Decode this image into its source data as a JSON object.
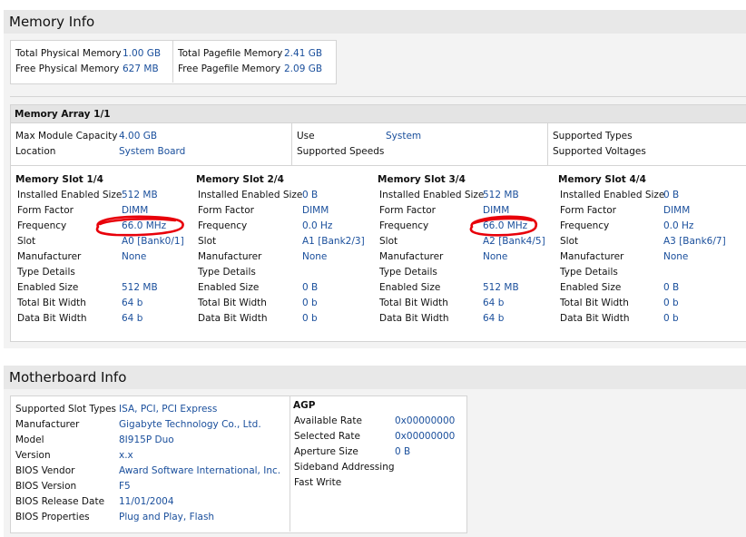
{
  "memory": {
    "title": "Memory Info",
    "summary": [
      {
        "label": "Total Physical Memory",
        "value": "1.00 GB"
      },
      {
        "label": "Free Physical Memory",
        "value": "627 MB"
      },
      {
        "label": "Total Pagefile Memory",
        "value": "2.41 GB"
      },
      {
        "label": "Free Pagefile Memory",
        "value": "2.09 GB"
      }
    ],
    "array": {
      "title": "Memory Array 1/1",
      "max_module_label": "Max Module Capacity",
      "max_module_value": "4.00 GB",
      "location_label": "Location",
      "location_value": "System Board",
      "use_label": "Use",
      "use_value": "System",
      "supported_speeds_label": "Supported Speeds",
      "supported_types_label": "Supported Types",
      "supported_voltages_label": "Supported Voltages"
    },
    "slot_labels": [
      "Installed Enabled Size",
      "Form Factor",
      "Frequency",
      "Slot",
      "Manufacturer",
      "Type Details",
      "Enabled Size",
      "Total Bit Width",
      "Data Bit Width"
    ],
    "slots": [
      {
        "title": "Memory Slot 1/4",
        "values": [
          "512 MB",
          "DIMM",
          "66.0 MHz",
          "A0 [Bank0/1]",
          "None",
          "",
          "512 MB",
          "64 b",
          "64 b"
        ]
      },
      {
        "title": "Memory Slot 2/4",
        "values": [
          "0 B",
          "DIMM",
          "0.0 Hz",
          "A1 [Bank2/3]",
          "None",
          "",
          "0 B",
          "0 b",
          "0 b"
        ]
      },
      {
        "title": "Memory Slot 3/4",
        "values": [
          "512 MB",
          "DIMM",
          "66.0 MHz",
          "A2 [Bank4/5]",
          "None",
          "",
          "512 MB",
          "64 b",
          "64 b"
        ]
      },
      {
        "title": "Memory Slot 4/4",
        "values": [
          "0 B",
          "DIMM",
          "0.0 Hz",
          "A3 [Bank6/7]",
          "None",
          "",
          "0 B",
          "0 b",
          "0 b"
        ]
      }
    ]
  },
  "motherboard": {
    "title": "Motherboard Info",
    "rows": [
      {
        "label": "Supported Slot Types",
        "value": "ISA, PCI, PCI Express"
      },
      {
        "label": "Manufacturer",
        "value": "Gigabyte Technology Co., Ltd."
      },
      {
        "label": "Model",
        "value": "8I915P Duo"
      },
      {
        "label": "Version",
        "value": "x.x"
      },
      {
        "label": "BIOS Vendor",
        "value": "Award Software International, Inc."
      },
      {
        "label": "BIOS Version",
        "value": "F5"
      },
      {
        "label": "BIOS Release Date",
        "value": "11/01/2004"
      },
      {
        "label": "BIOS Properties",
        "value": "Plug and Play, Flash"
      }
    ],
    "agp": {
      "title": "AGP",
      "rows": [
        {
          "label": "Available Rate",
          "value": "0x00000000"
        },
        {
          "label": "Selected Rate",
          "value": "0x00000000"
        },
        {
          "label": "Aperture Size",
          "value": "0 B"
        },
        {
          "label": "Sideband Addressing",
          "value": ""
        },
        {
          "label": "Fast Write",
          "value": ""
        }
      ]
    }
  },
  "annotations": {
    "color": "#e8000a"
  }
}
